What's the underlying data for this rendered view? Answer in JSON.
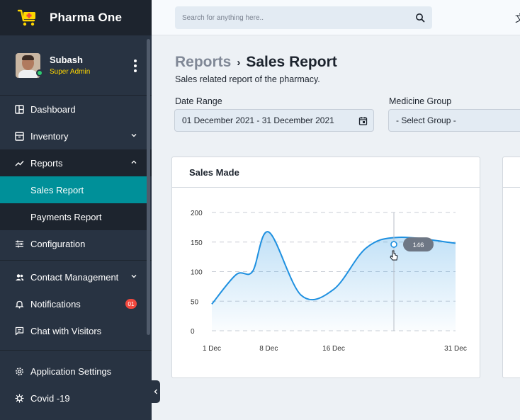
{
  "brand": {
    "name": "Pharma One"
  },
  "user": {
    "name": "Subash",
    "role": "Super Admin"
  },
  "nav": {
    "dashboard": "Dashboard",
    "inventory": "Inventory",
    "reports": "Reports",
    "sales_report": "Sales Report",
    "payments_report": "Payments Report",
    "configuration": "Configuration",
    "contact_management": "Contact Management",
    "notifications": "Notifications",
    "notifications_badge": "01",
    "chat": "Chat with Visitors",
    "app_settings": "Application Settings",
    "covid": "Covid -19"
  },
  "search": {
    "placeholder": "Search for anything here.."
  },
  "page": {
    "breadcrumb_parent": "Reports",
    "breadcrumb_sep": "›",
    "breadcrumb_current": "Sales Report",
    "subtitle": "Sales related report of the pharmacy."
  },
  "filters": {
    "date_range_label": "Date Range",
    "date_range_value": "01 December 2021 - 31 December 2021",
    "medicine_group_label": "Medicine Group",
    "medicine_group_value": "- Select Group -"
  },
  "colors": {
    "accent": "#009099",
    "line": "#1e90e0",
    "badge": "#f0483e"
  },
  "chart_data": {
    "type": "area",
    "title": "Sales Made",
    "x_ticks": [
      "1 Dec",
      "8 Dec",
      "16 Dec",
      "31 Dec"
    ],
    "y_ticks": [
      "0",
      "50",
      "100",
      "150",
      "200"
    ],
    "ylim": [
      0,
      200
    ],
    "points": [
      {
        "x": "1 Dec",
        "y": 45
      },
      {
        "x": "4 Dec",
        "y": 95
      },
      {
        "x": "6 Dec",
        "y": 100
      },
      {
        "x": "8 Dec",
        "y": 167
      },
      {
        "x": "12 Dec",
        "y": 60
      },
      {
        "x": "16 Dec",
        "y": 70
      },
      {
        "x": "20 Dec",
        "y": 140
      },
      {
        "x": "24 Dec",
        "y": 158
      },
      {
        "x": "31 Dec",
        "y": 148
      }
    ],
    "tooltip_value": "146"
  }
}
